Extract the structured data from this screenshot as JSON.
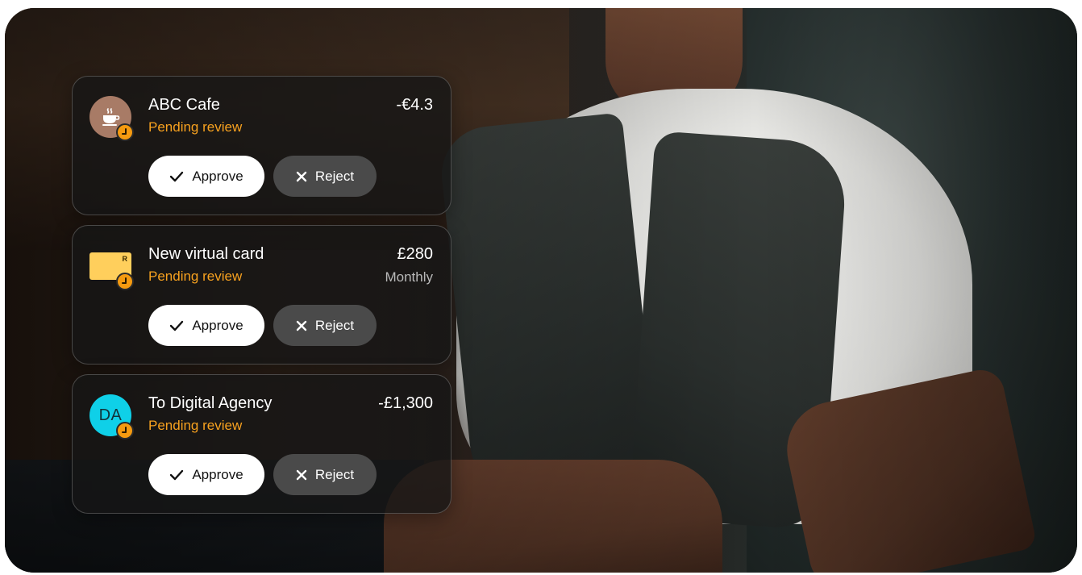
{
  "requests": [
    {
      "icon": "coffee-cup-icon",
      "title": "ABC Cafe",
      "status": "Pending review",
      "amount": "-€4.3",
      "sub_amount": "",
      "approve_label": "Approve",
      "reject_label": "Reject"
    },
    {
      "icon": "virtual-card-icon",
      "card_mark": "R",
      "title": "New virtual card",
      "status": "Pending review",
      "amount": "£280",
      "sub_amount": "Monthly",
      "approve_label": "Approve",
      "reject_label": "Reject"
    },
    {
      "icon": "initials-avatar",
      "initials": "DA",
      "title": "To Digital Agency",
      "status": "Pending review",
      "amount": "-£1,300",
      "sub_amount": "",
      "approve_label": "Approve",
      "reject_label": "Reject"
    }
  ],
  "colors": {
    "pending": "#f7a11f",
    "badge": "#f59a10",
    "cafe_avatar": "#a87b66",
    "card_yellow": "#ffcf5c",
    "agency_avatar": "#0fd0e8",
    "approve_bg": "#ffffff",
    "reject_bg": "#4a4a4a"
  }
}
